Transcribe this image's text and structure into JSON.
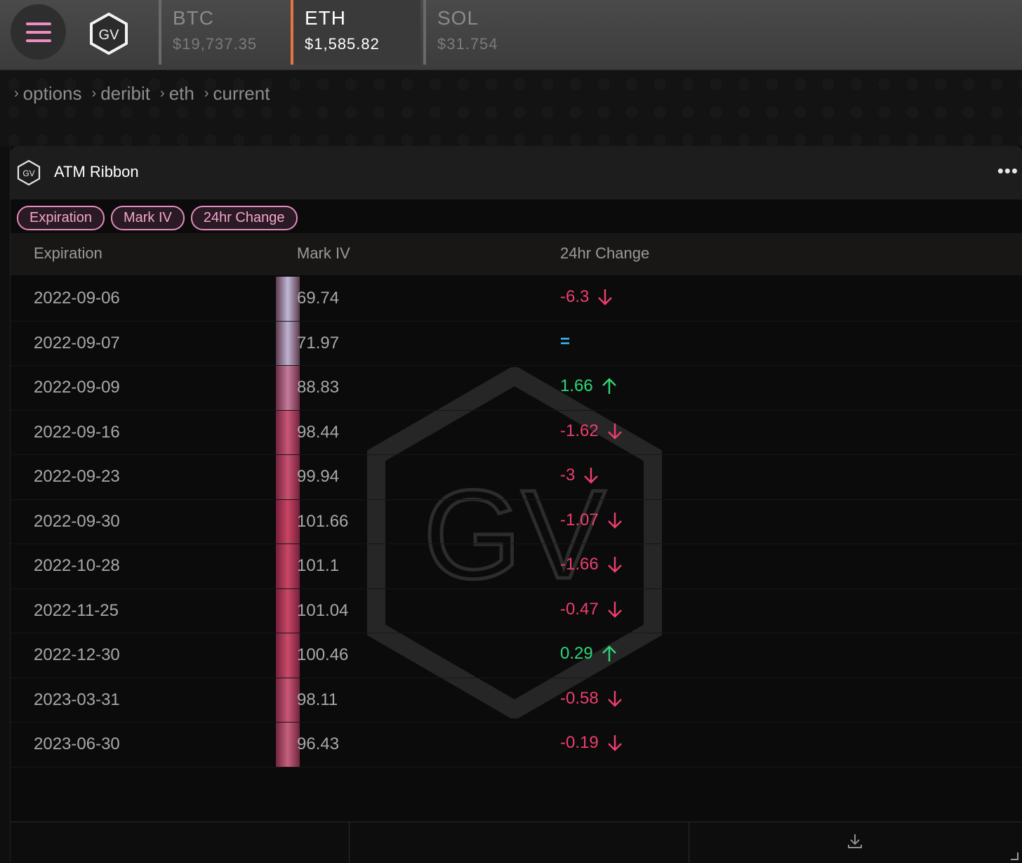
{
  "tickers": [
    {
      "symbol": "BTC",
      "price": "$19,737.35",
      "active": false
    },
    {
      "symbol": "ETH",
      "price": "$1,585.82",
      "active": true
    },
    {
      "symbol": "SOL",
      "price": "$31.754",
      "active": false
    }
  ],
  "logo_text": "GV",
  "breadcrumb": [
    "options",
    "deribit",
    "eth",
    "current"
  ],
  "panel": {
    "title": "ATM Ribbon",
    "chips": [
      "Expiration",
      "Mark IV",
      "24hr Change"
    ],
    "columns": [
      "Expiration",
      "Mark IV",
      "24hr Change"
    ],
    "rows": [
      {
        "expiration": "2022-09-06",
        "mark_iv": "69.74",
        "change": "-6.3",
        "direction": "down",
        "ribbon_level": 0.05
      },
      {
        "expiration": "2022-09-07",
        "mark_iv": "71.97",
        "change": "=",
        "direction": "flat",
        "ribbon_level": 0.1
      },
      {
        "expiration": "2022-09-09",
        "mark_iv": "88.83",
        "change": "1.66",
        "direction": "up",
        "ribbon_level": 0.55
      },
      {
        "expiration": "2022-09-16",
        "mark_iv": "98.44",
        "change": "-1.62",
        "direction": "down",
        "ribbon_level": 0.85
      },
      {
        "expiration": "2022-09-23",
        "mark_iv": "99.94",
        "change": "-3",
        "direction": "down",
        "ribbon_level": 0.9
      },
      {
        "expiration": "2022-09-30",
        "mark_iv": "101.66",
        "change": "-1.07",
        "direction": "down",
        "ribbon_level": 1.0
      },
      {
        "expiration": "2022-10-28",
        "mark_iv": "101.1",
        "change": "-1.66",
        "direction": "down",
        "ribbon_level": 0.98
      },
      {
        "expiration": "2022-11-25",
        "mark_iv": "101.04",
        "change": "-0.47",
        "direction": "down",
        "ribbon_level": 0.98
      },
      {
        "expiration": "2022-12-30",
        "mark_iv": "100.46",
        "change": "0.29",
        "direction": "up",
        "ribbon_level": 0.95
      },
      {
        "expiration": "2023-03-31",
        "mark_iv": "98.11",
        "change": "-0.58",
        "direction": "down",
        "ribbon_level": 0.85
      },
      {
        "expiration": "2023-06-30",
        "mark_iv": "96.43",
        "change": "-0.19",
        "direction": "down",
        "ribbon_level": 0.78
      }
    ]
  },
  "colors": {
    "accent_pink": "#f08cc4",
    "active_tab": "#e57544",
    "negative": "#ec3f6e",
    "positive": "#2fd679",
    "flat": "#35b3ee"
  },
  "icons": [
    "menu-icon",
    "gv-logo-icon",
    "chevron-right-icon",
    "more-icon",
    "arrow-down-icon",
    "arrow-up-icon",
    "download-icon",
    "resize-handle-icon"
  ]
}
